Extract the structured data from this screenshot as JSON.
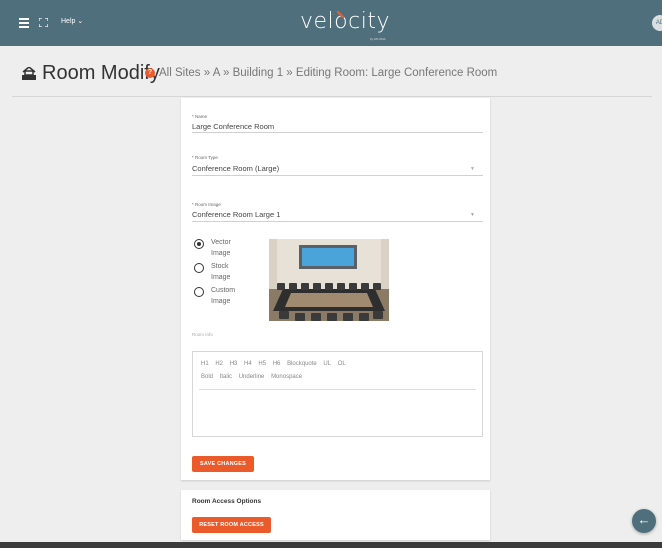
{
  "topbar": {
    "help_label": "Help",
    "logo_text": "velocity",
    "logo_sub": "by ATLONA",
    "icons": [
      "menu-icon",
      "fullscreen-icon",
      "chevron-down-icon",
      "avatar"
    ],
    "avatar_initials": "AD"
  },
  "header": {
    "title": "Room Modify",
    "breadcrumb": [
      "All Sites",
      "A",
      "Building 1"
    ],
    "breadcrumb_sep": "»",
    "editing": "Editing Room: Large Conference Room"
  },
  "form": {
    "name_label": "* Name",
    "name_value": "Large Conference Room",
    "type_label": "* Room Type",
    "type_value": "Conference Room (Large)",
    "image_label": "* Room Image",
    "image_value": "Conference Room Large 1",
    "image_options": [
      {
        "label_line1": "Vector",
        "label_line2": "Image",
        "selected": true
      },
      {
        "label_line1": "Stock",
        "label_line2": "Image",
        "selected": false
      },
      {
        "label_line1": "Custom",
        "label_line2": "Image",
        "selected": false
      }
    ],
    "room_info_label": "Room Info",
    "editor_row1": [
      "H1",
      "H2",
      "H3",
      "H4",
      "H5",
      "H6",
      "Blockquote",
      "UL",
      "OL"
    ],
    "editor_row2": [
      "Bold",
      "Italic",
      "Underline",
      "Monospace"
    ],
    "save_label": "SAVE CHANGES"
  },
  "access": {
    "title": "Room Access Options",
    "reset_label": "RESET ROOM ACCESS"
  },
  "colors": {
    "topbar": "#4f6f7d",
    "accent": "#ea5a2b",
    "background": "#eeeeee"
  }
}
